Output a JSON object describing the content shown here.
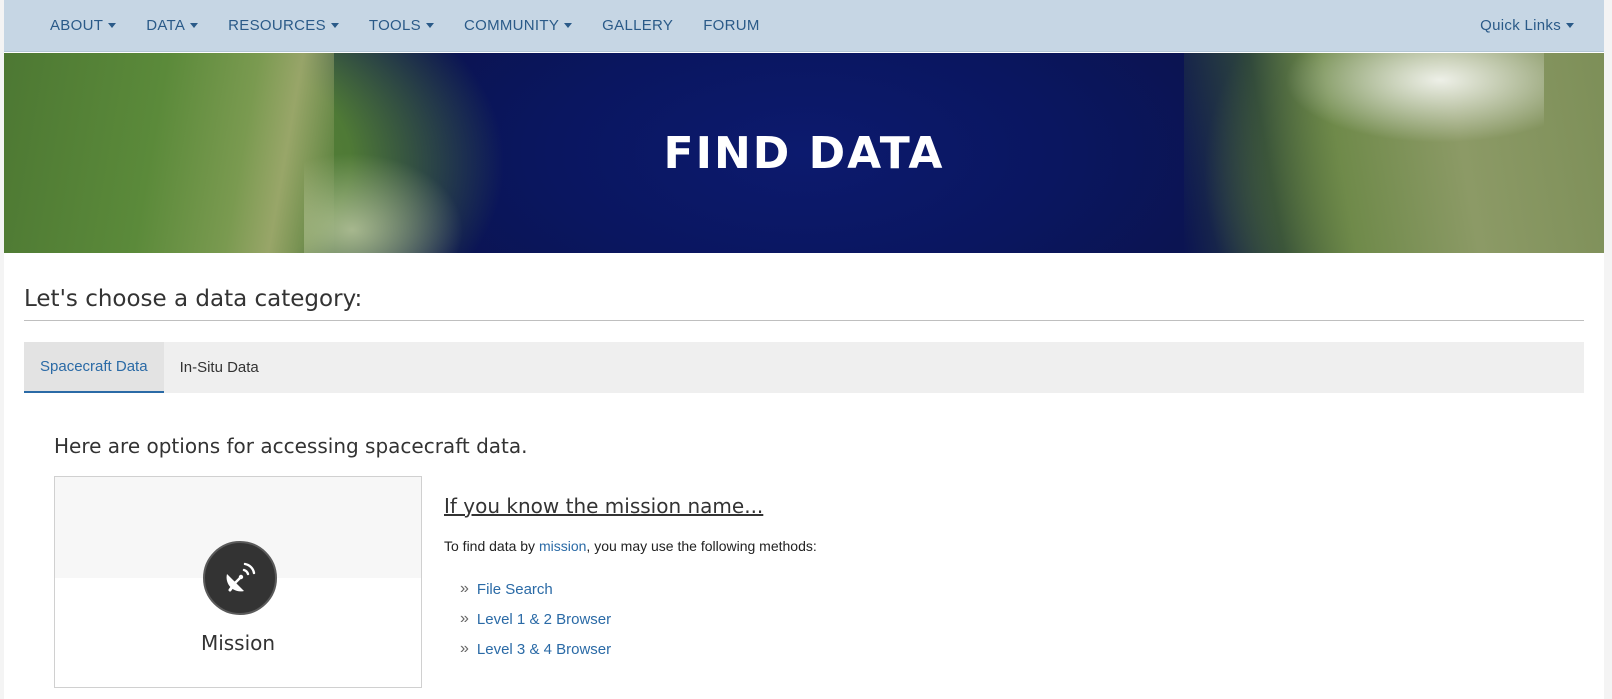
{
  "nav": {
    "items": [
      {
        "label": "ABOUT",
        "dropdown": true
      },
      {
        "label": "DATA",
        "dropdown": true
      },
      {
        "label": "RESOURCES",
        "dropdown": true
      },
      {
        "label": "TOOLS",
        "dropdown": true
      },
      {
        "label": "COMMUNITY",
        "dropdown": true
      },
      {
        "label": "GALLERY",
        "dropdown": false
      },
      {
        "label": "FORUM",
        "dropdown": false
      }
    ],
    "quick_links": "Quick Links"
  },
  "hero": {
    "title": "FIND DATA"
  },
  "section": {
    "heading": "Let's choose a data category:"
  },
  "tabs": [
    {
      "label": "Spacecraft Data",
      "active": true
    },
    {
      "label": "In-Situ Data",
      "active": false
    }
  ],
  "content": {
    "intro": "Here are options for accessing spacecraft data.",
    "card": {
      "icon": "satellite-dish-icon",
      "label": "Mission"
    },
    "mission": {
      "heading": "If you know the mission name...",
      "text_before": "To find data by ",
      "text_link": "mission",
      "text_after": ", you may use the following methods:",
      "methods": [
        "File Search",
        "Level 1 & 2 Browser",
        "Level 3 & 4 Browser"
      ]
    }
  },
  "colors": {
    "nav_bg": "#c6d6e4",
    "nav_text": "#2a5a88",
    "link": "#2a6aa6",
    "tab_bar_bg": "#efefef"
  }
}
